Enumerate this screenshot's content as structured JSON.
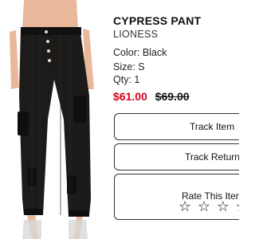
{
  "product": {
    "name": "CYPRESS PANT",
    "brand": "LIONESS",
    "color_label": "Color: Black",
    "size_label": "Size: S",
    "qty_label": "Qty: 1",
    "sale_price": "$61.00",
    "original_price": "$69.00",
    "sale_color": "#d0021b",
    "image_icon": "black-cargo-pants-photo"
  },
  "actions": {
    "track_label": "Track Item",
    "return_label": "Track Return",
    "rate_label": "Rate This Item",
    "rating": {
      "value": 0,
      "max": 5,
      "star_glyph": "☆"
    }
  }
}
